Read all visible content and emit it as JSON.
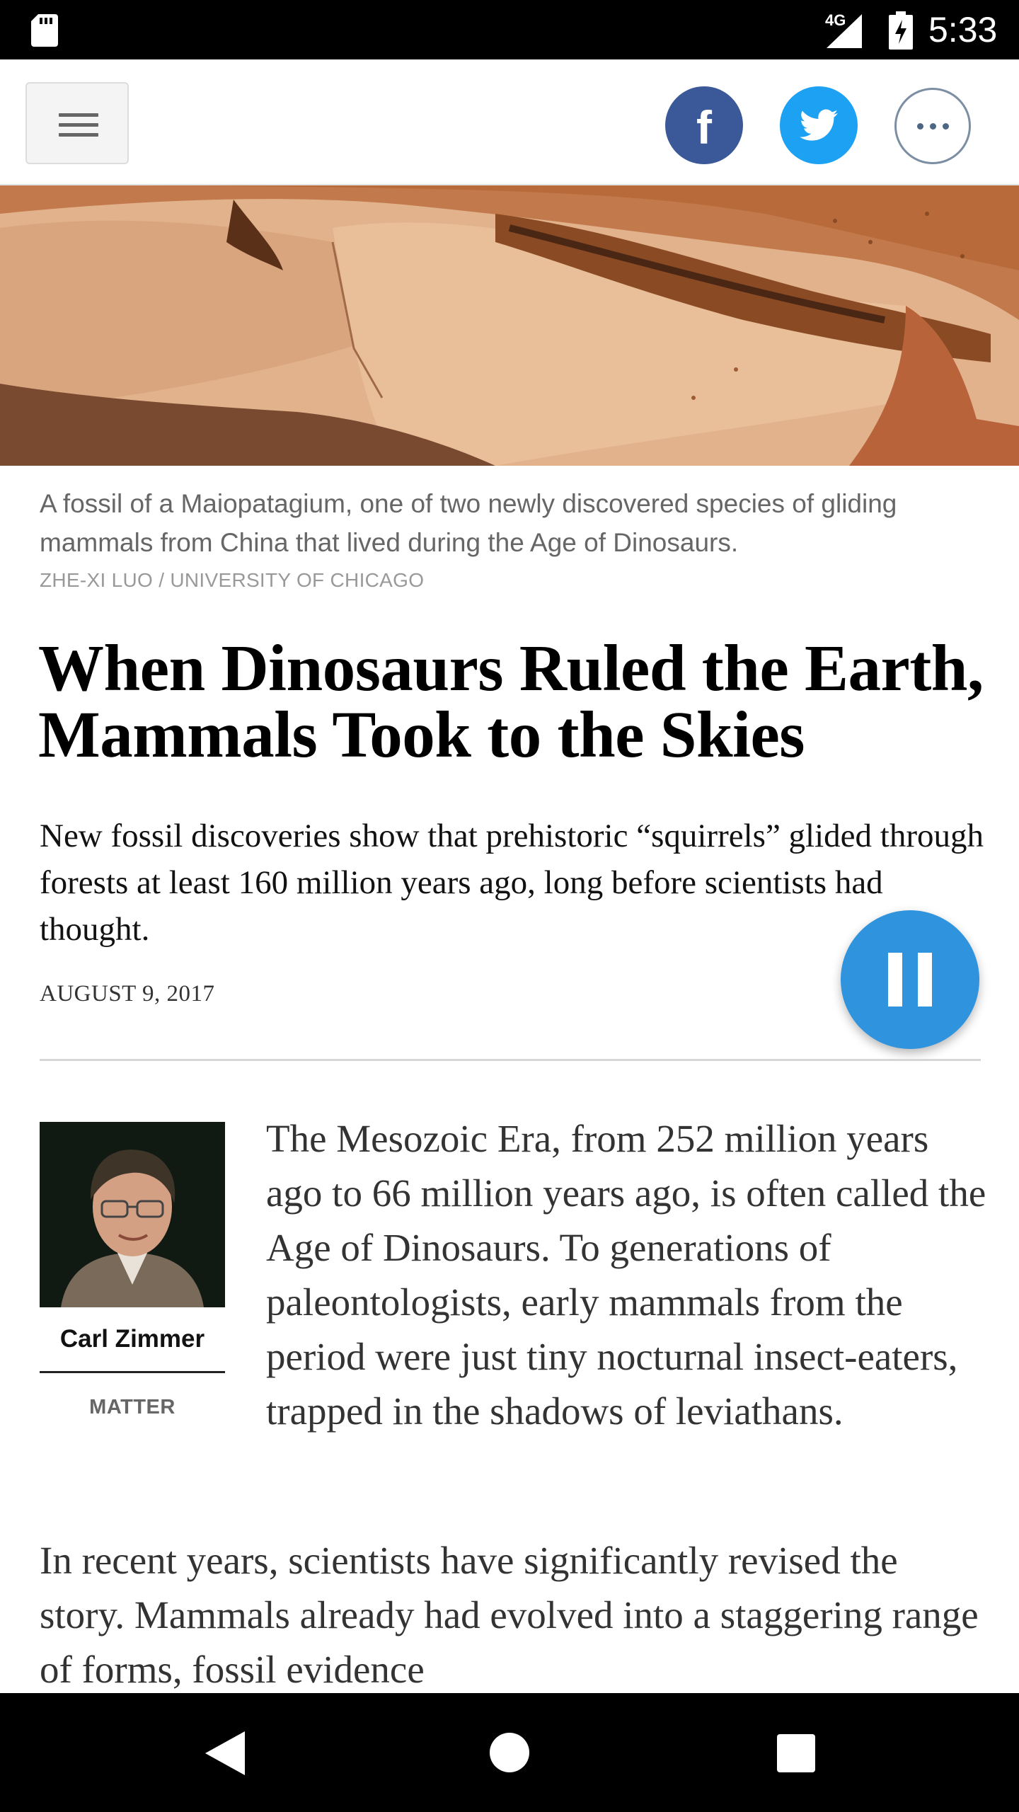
{
  "status_bar": {
    "network": "4G",
    "time": "5:33",
    "icons": [
      "sd-card-icon",
      "signal-icon",
      "battery-charging-icon"
    ]
  },
  "toolbar": {
    "menu_icon": "hamburger-menu-icon",
    "facebook_label": "f",
    "twitter_icon": "twitter-bird-icon",
    "more_icon": "more-dots-icon"
  },
  "hero": {
    "caption": "A fossil of a Maiopatagium, one of two newly discovered species of gliding mammals from China that lived during the Age of Dinosaurs.",
    "credit": "ZHE-XI LUO / UNIVERSITY OF CHICAGO"
  },
  "article": {
    "headline": "When Dinosaurs Ruled the Earth, Mammals Took to the Skies",
    "summary": "New fossil discoveries show that prehistoric “squirrels” glided through forests at least 160 million years ago, long before scientists had thought.",
    "date": "AUGUST 9, 2017",
    "author": "Carl Zimmer",
    "column": "MATTER",
    "paragraphs": [
      "The Mesozoic Era, from 252 million years ago to 66 million years ago, is often called the Age of Dinosaurs. To generations of paleontologists, early mammals from the period were just tiny nocturnal insect-eaters, trapped in the shadows of leviathans.",
      "In recent years, scientists have significantly revised the story. Mammals already had evolved into a staggering range of forms, fossil evidence"
    ]
  },
  "audio_player": {
    "state_icon": "pause-icon"
  },
  "nav_bar": {
    "icons": [
      "back-icon",
      "home-icon",
      "recents-icon"
    ]
  },
  "colors": {
    "facebook": "#3b5998",
    "twitter": "#1da1f2",
    "audio_button": "#2f93dd"
  }
}
